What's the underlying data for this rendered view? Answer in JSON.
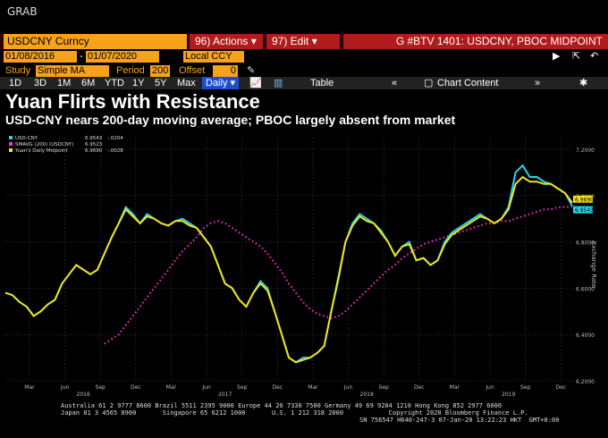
{
  "header": {
    "grab": "GRAB"
  },
  "toolbar": {
    "ticker": "USDCNY Curncy",
    "actions": "96) Actions ▾",
    "edit": "97) Edit ▾",
    "title": "G #BTV 1401: USDCNY, PBOC MIDPOINT"
  },
  "range": {
    "start": "01/08/2016",
    "end": "01/07/2020",
    "currency": "Local CCY"
  },
  "study": {
    "label": "Study",
    "value": "Simple MA",
    "period_label": "Period",
    "period": "200",
    "offset_label": "Offset",
    "offset": "0"
  },
  "periods": [
    "1D",
    "3D",
    "1M",
    "6M",
    "YTD",
    "1Y",
    "5Y",
    "Max"
  ],
  "frequency": "Daily ▾",
  "table_label": "Table",
  "chart_content_label": "Chart Content",
  "headline": "Yuan Flirts with Resistance",
  "subheadline": "USD-CNY nears 200-day moving average; PBOC largely absent from market",
  "chart_data": {
    "type": "line",
    "ylabel": "Exchange Rate",
    "ylim": [
      6.2,
      7.25
    ],
    "yticks": [
      "7.2000",
      "7.0000",
      "6.8000",
      "6.6000",
      "6.4000",
      "6.2000"
    ],
    "xticks": [
      "Mar",
      "Jun",
      "Sep",
      "Dec",
      "Mar",
      "Jun",
      "Sep",
      "Dec",
      "Mar",
      "Jun",
      "Sep",
      "Dec",
      "Mar",
      "Jun",
      "Sep",
      "Dec"
    ],
    "years": [
      "2016",
      "2017",
      "2018",
      "2019"
    ],
    "legend": [
      {
        "name": "USD-CNY",
        "last": "6.9543",
        "chg": "-.0204",
        "color": "#2ad4e6"
      },
      {
        "name": "SMAVG (200) (USDCNY)",
        "last": "6.9523",
        "chg": "",
        "color": "#ff2fd0"
      },
      {
        "name": "Yuan's Daily Midpoint",
        "last": "6.9690",
        "chg": "-.0028",
        "color": "#f2e21a"
      }
    ],
    "last_labels": [
      "6.9690",
      "6.9543"
    ],
    "x": [
      0,
      0.05,
      0.1,
      0.15,
      0.2,
      0.25,
      0.3,
      0.35,
      0.4,
      0.45,
      0.5,
      0.55,
      0.6,
      0.65,
      0.7,
      0.75,
      0.8,
      0.85,
      0.9,
      0.95,
      1.0,
      1.05,
      1.1,
      1.15,
      1.2,
      1.25,
      1.3,
      1.35,
      1.4,
      1.45,
      1.5,
      1.55,
      1.6,
      1.65,
      1.7,
      1.75,
      1.8,
      1.85,
      1.9,
      1.95,
      2.0,
      2.05,
      2.1,
      2.15,
      2.2,
      2.25,
      2.3,
      2.35,
      2.4,
      2.45,
      2.5,
      2.55,
      2.6,
      2.65,
      2.7,
      2.75,
      2.8,
      2.85,
      2.9,
      2.95,
      3.0,
      3.05,
      3.1,
      3.15,
      3.2,
      3.25,
      3.3,
      3.35,
      3.4,
      3.45,
      3.5,
      3.55,
      3.6,
      3.65,
      3.7,
      3.75,
      3.8,
      3.85,
      3.9,
      3.95,
      4.0
    ],
    "usdcny": [
      6.58,
      6.57,
      6.54,
      6.52,
      6.48,
      6.5,
      6.53,
      6.55,
      6.62,
      6.66,
      6.7,
      6.68,
      6.66,
      6.68,
      6.75,
      6.82,
      6.88,
      6.95,
      6.92,
      6.88,
      6.92,
      6.9,
      6.88,
      6.87,
      6.89,
      6.9,
      6.88,
      6.86,
      6.82,
      6.78,
      6.7,
      6.62,
      6.6,
      6.55,
      6.52,
      6.58,
      6.63,
      6.6,
      6.5,
      6.4,
      6.3,
      6.28,
      6.3,
      6.3,
      6.32,
      6.35,
      6.5,
      6.65,
      6.8,
      6.88,
      6.92,
      6.9,
      6.88,
      6.85,
      6.8,
      6.74,
      6.78,
      6.8,
      6.72,
      6.73,
      6.7,
      6.72,
      6.8,
      6.84,
      6.86,
      6.88,
      6.9,
      6.92,
      6.9,
      6.88,
      6.9,
      6.95,
      7.1,
      7.13,
      7.08,
      7.08,
      7.06,
      7.05,
      7.03,
      7.01,
      6.9543
    ],
    "midpoint": [
      6.58,
      6.57,
      6.54,
      6.52,
      6.48,
      6.5,
      6.53,
      6.55,
      6.62,
      6.66,
      6.7,
      6.68,
      6.66,
      6.68,
      6.75,
      6.82,
      6.88,
      6.94,
      6.91,
      6.88,
      6.91,
      6.9,
      6.88,
      6.87,
      6.89,
      6.89,
      6.87,
      6.86,
      6.82,
      6.78,
      6.7,
      6.62,
      6.6,
      6.55,
      6.52,
      6.58,
      6.62,
      6.59,
      6.5,
      6.4,
      6.3,
      6.28,
      6.29,
      6.3,
      6.32,
      6.35,
      6.5,
      6.64,
      6.8,
      6.87,
      6.91,
      6.89,
      6.88,
      6.84,
      6.8,
      6.74,
      6.78,
      6.79,
      6.72,
      6.73,
      6.7,
      6.72,
      6.79,
      6.83,
      6.85,
      6.87,
      6.89,
      6.91,
      6.9,
      6.88,
      6.9,
      6.94,
      7.05,
      7.08,
      7.06,
      7.06,
      7.05,
      7.05,
      7.03,
      7.01,
      6.969
    ],
    "sma": [
      null,
      null,
      null,
      null,
      null,
      null,
      null,
      null,
      null,
      null,
      null,
      null,
      null,
      null,
      6.36,
      6.38,
      6.4,
      6.44,
      6.48,
      6.52,
      6.56,
      6.6,
      6.64,
      6.68,
      6.72,
      6.76,
      6.79,
      6.82,
      6.86,
      6.88,
      6.89,
      6.88,
      6.86,
      6.84,
      6.82,
      6.8,
      6.78,
      6.75,
      6.71,
      6.67,
      6.62,
      6.58,
      6.54,
      6.51,
      6.49,
      6.48,
      6.47,
      6.48,
      6.5,
      6.53,
      6.56,
      6.59,
      6.62,
      6.65,
      6.68,
      6.7,
      6.73,
      6.75,
      6.77,
      6.79,
      6.8,
      6.81,
      6.82,
      6.83,
      6.84,
      6.85,
      6.86,
      6.87,
      6.88,
      6.88,
      6.89,
      6.89,
      6.9,
      6.91,
      6.92,
      6.93,
      6.94,
      6.94,
      6.95,
      6.95,
      6.9523
    ]
  },
  "footer": {
    "line1": "Australia 61 2 9777 8600 Brazil 5511 2395 9000 Europe 44 20 7330 7500 Germany 49 69 9204 1210 Hong Kong 852 2977 6000",
    "line2": "Japan 81 3 4565 8900       Singapore 65 6212 1000       U.S. 1 212 318 2000            Copyright 2020 Bloomberg Finance L.P.",
    "line3": "SN 756547 H640-247-3 07-Jan-20 13:22:23 HKT  GMT+8:00"
  }
}
